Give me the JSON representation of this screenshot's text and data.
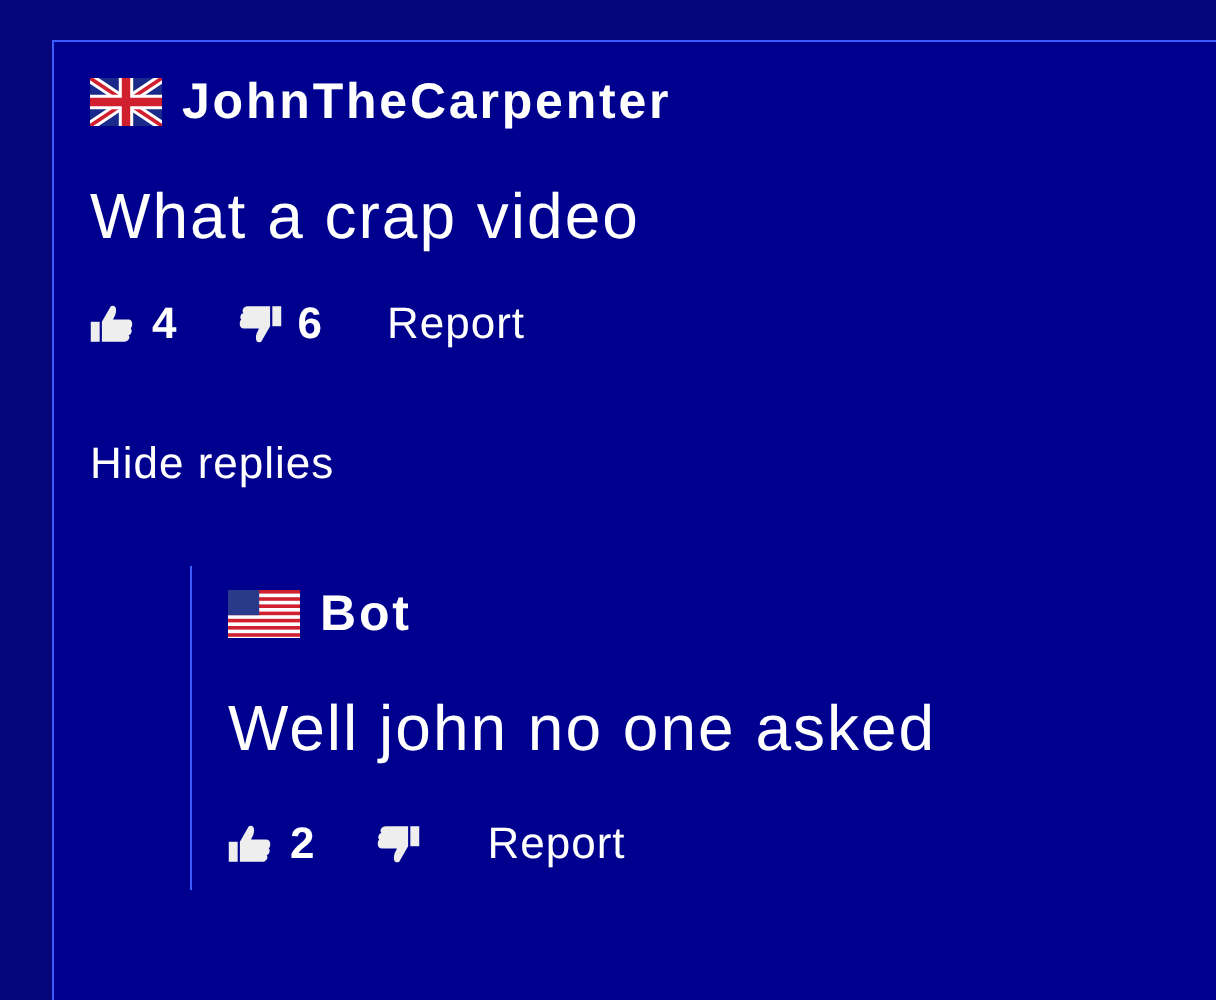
{
  "comment": {
    "author": "JohnTheCarpenter",
    "kind": "uk",
    "text": "What a crap video",
    "likes": "4",
    "dislikes": "6",
    "report": "Report"
  },
  "hide_replies": "Hide replies",
  "replies": [
    {
      "author": "Bot",
      "kind": "us",
      "text": "Well john no one asked",
      "likes": "2",
      "report": "Report"
    }
  ]
}
